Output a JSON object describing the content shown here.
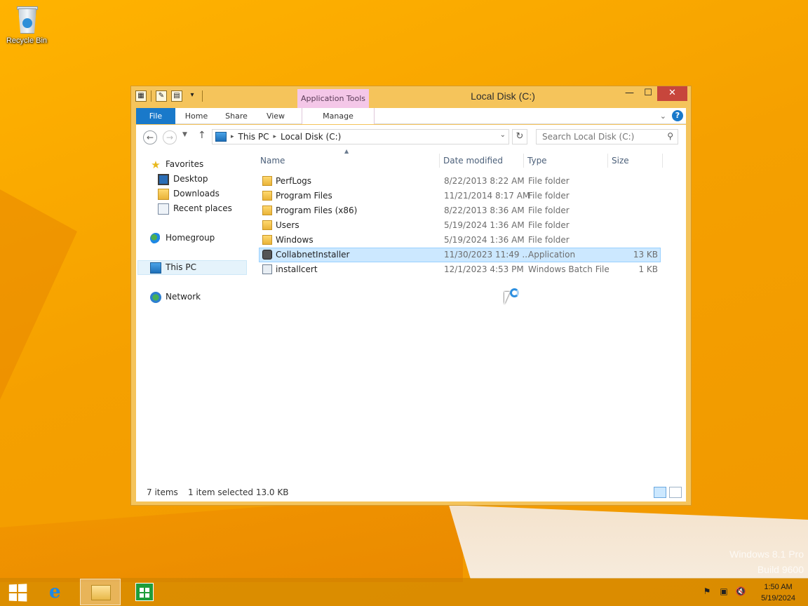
{
  "desktop": {
    "recycle_bin_label": "Recycle Bin",
    "watermark_line1": "Windows 8.1 Pro",
    "watermark_line2": "Build 9600"
  },
  "window": {
    "title": "Local Disk (C:)",
    "contextual_tab_group": "Application Tools",
    "controls": {
      "minimize": "—",
      "maximize": "☐",
      "close": "✕"
    }
  },
  "ribbon": {
    "tabs": [
      "File",
      "Home",
      "Share",
      "View",
      "Manage"
    ],
    "help": "?"
  },
  "address": {
    "breadcrumbs": [
      "This PC",
      "Local Disk (C:)"
    ],
    "search_placeholder": "Search Local Disk (C:)"
  },
  "nav_pane": {
    "favorites": "Favorites",
    "favorite_items": [
      "Desktop",
      "Downloads",
      "Recent places"
    ],
    "homegroup": "Homegroup",
    "this_pc": "This PC",
    "network": "Network"
  },
  "columns": {
    "name": "Name",
    "date": "Date modified",
    "type": "Type",
    "size": "Size"
  },
  "files": [
    {
      "name": "PerfLogs",
      "date": "8/22/2013 8:22 AM",
      "type": "File folder",
      "size": "",
      "icon": "folder-icon"
    },
    {
      "name": "Program Files",
      "date": "11/21/2014 8:17 AM",
      "type": "File folder",
      "size": "",
      "icon": "folder-icon"
    },
    {
      "name": "Program Files (x86)",
      "date": "8/22/2013 8:36 AM",
      "type": "File folder",
      "size": "",
      "icon": "folder-icon"
    },
    {
      "name": "Users",
      "date": "5/19/2024 1:36 AM",
      "type": "File folder",
      "size": "",
      "icon": "folder-icon"
    },
    {
      "name": "Windows",
      "date": "5/19/2024 1:36 AM",
      "type": "File folder",
      "size": "",
      "icon": "folder-icon"
    },
    {
      "name": "CollabnetInstaller",
      "date": "11/30/2023 11:49 ...",
      "type": "Application",
      "size": "13 KB",
      "icon": "application-icon",
      "selected": true
    },
    {
      "name": "installcert",
      "date": "12/1/2023 4:53 PM",
      "type": "Windows Batch File",
      "size": "1 KB",
      "icon": "batch-file-icon"
    }
  ],
  "status": {
    "item_count": "7 items",
    "selection": "1 item selected  13.0 KB"
  },
  "taskbar": {
    "clock_time": "1:50 AM",
    "clock_date": "5/19/2024"
  },
  "colors": {
    "accent": "#1979ca",
    "title_bar": "#f5c45b",
    "selection": "#cce8ff",
    "close_button": "#c7463c",
    "context_tab": "#f4c7e8"
  }
}
